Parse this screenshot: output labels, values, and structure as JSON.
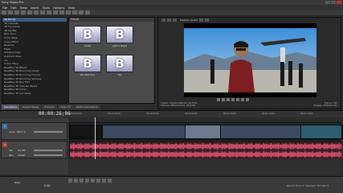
{
  "window": {
    "title": "Sony Vegas Pro"
  },
  "menu": [
    "File",
    "Edit",
    "View",
    "Insert",
    "Tools",
    "Options",
    "Help"
  ],
  "fx_list": {
    "items": [
      "3D Blinds",
      "3D Cascade",
      "3D Fly In/Out",
      "3D Shuffle",
      "Barn Door",
      "Clock Wipe",
      "Cross Effect",
      "Dissolve",
      "Flash",
      "Gradient Map",
      "Gradient Wipe",
      "Iris",
      "Linear Wipe",
      "NewBlue 3D Blinds",
      "NewBlue 3D Bouncing Cubes",
      "NewBlue 3D Bouncing Frames",
      "NewBlue 3D Bouncing Spheres",
      "NewBlue 3D Box Fold",
      "NewBlue 3D Checker Board",
      "NewBlue 3D Cover",
      "NewBlue 3D Cut Away"
    ],
    "selected_index": 0
  },
  "preset_panel": {
    "header": "Preset:",
    "presets": [
      {
        "letter": "B",
        "label": "Small"
      },
      {
        "letter": "B",
        "label": "Left to Right"
      },
      {
        "letter": "B",
        "label": "Bot Machine"
      },
      {
        "letter": "B",
        "label": "Top"
      }
    ]
  },
  "tabs": [
    "Transitions",
    "Project Media",
    "Explorer",
    "Video FX",
    "Media Generators"
  ],
  "preview": {
    "mode_label": "Preview (Auto)",
    "info": {
      "project": "Project: 1920x1080x32, 29.970p",
      "preview": "Preview: 480x270x32, 29.970p",
      "frame": "Frame: 793",
      "display": "Display: 403x227x32"
    }
  },
  "timeline": {
    "timecode": "00:00:26;06",
    "ruler_ticks": [
      "00:00:00;00",
      "00:00:30;00",
      "00:00:40;00",
      "00:00:50;00",
      "00:01:00;00",
      "00:01:10;00",
      "00:01:20;00"
    ],
    "video_track": {
      "number": "1",
      "level_label": "Level: 100.0 %"
    },
    "audio_track": {
      "number": "2",
      "vol_label": "Vol:",
      "vol_value": "0.0 dB",
      "pan_label": "Pan:",
      "pan_value": "Center"
    }
  },
  "status": {
    "rate_label": "Rate:",
    "rate_value": "0.00",
    "record_time": "Record Time (2 channels): 307:08:13"
  },
  "colors": {
    "audio_wave": "#c24b63",
    "video_track": "#2f3b4d",
    "selection": "#3d5a7a"
  }
}
